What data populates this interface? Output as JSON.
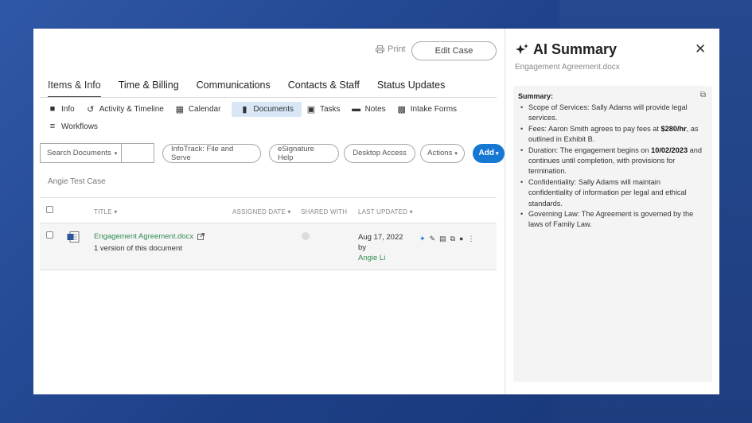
{
  "header": {
    "print_label": "Print",
    "edit_case_label": "Edit Case"
  },
  "tabs": [
    {
      "label": "Items & Info",
      "active": true
    },
    {
      "label": "Time & Billing"
    },
    {
      "label": "Communications"
    },
    {
      "label": "Contacts & Staff"
    },
    {
      "label": "Status Updates"
    }
  ],
  "subnav": {
    "info": "Info",
    "activity": "Activity & Timeline",
    "calendar": "Calendar",
    "documents": "Documents",
    "tasks": "Tasks",
    "notes": "Notes",
    "intake": "Intake Forms",
    "workflows": "Workflows"
  },
  "toolbar": {
    "search_select": "Search Documents",
    "search_value": "",
    "infotrack": "InfoTrack: File and Serve",
    "esignature": "eSignature Help",
    "desktop": "Desktop Access",
    "actions": "Actions",
    "add": "Add"
  },
  "case_name": "Angie Test Case",
  "table": {
    "headers": {
      "title": "TITLE",
      "assigned": "ASSIGNED DATE",
      "shared": "SHARED WITH",
      "updated": "LAST UPDATED"
    },
    "rows": [
      {
        "title": "Engagement Agreement.docx",
        "versions": "1 version of this document",
        "updated_date": "Aug 17, 2022",
        "updated_by_label": "by",
        "updated_by": "Angie Li"
      }
    ]
  },
  "panel": {
    "title": "AI Summary",
    "subtitle": "Engagement Agreement.docx",
    "summary_label": "Summary",
    "items": [
      {
        "pre": "Scope of Services: Sally Adams will provide legal services.",
        "bold": "",
        "post": ""
      },
      {
        "pre": "Fees: Aaron Smith agrees to pay fees at ",
        "bold": "$280/hr",
        "post": ", as outlined in Exhibit B."
      },
      {
        "pre": "Duration: The engagement begins on ",
        "bold": "10/02/2023",
        "post": " and continues until completion, with provisions for termination."
      },
      {
        "pre": "Confidentiality: Sally Adams will maintain confidentiality of information per legal and ethical standards.",
        "bold": "",
        "post": ""
      },
      {
        "pre": "Governing Law: The Agreement is governed by the laws of Family Law.",
        "bold": "",
        "post": ""
      }
    ]
  },
  "colors": {
    "accent": "#1778d4",
    "link": "#2f8c55",
    "active_subnav": "#d8e6f6"
  }
}
